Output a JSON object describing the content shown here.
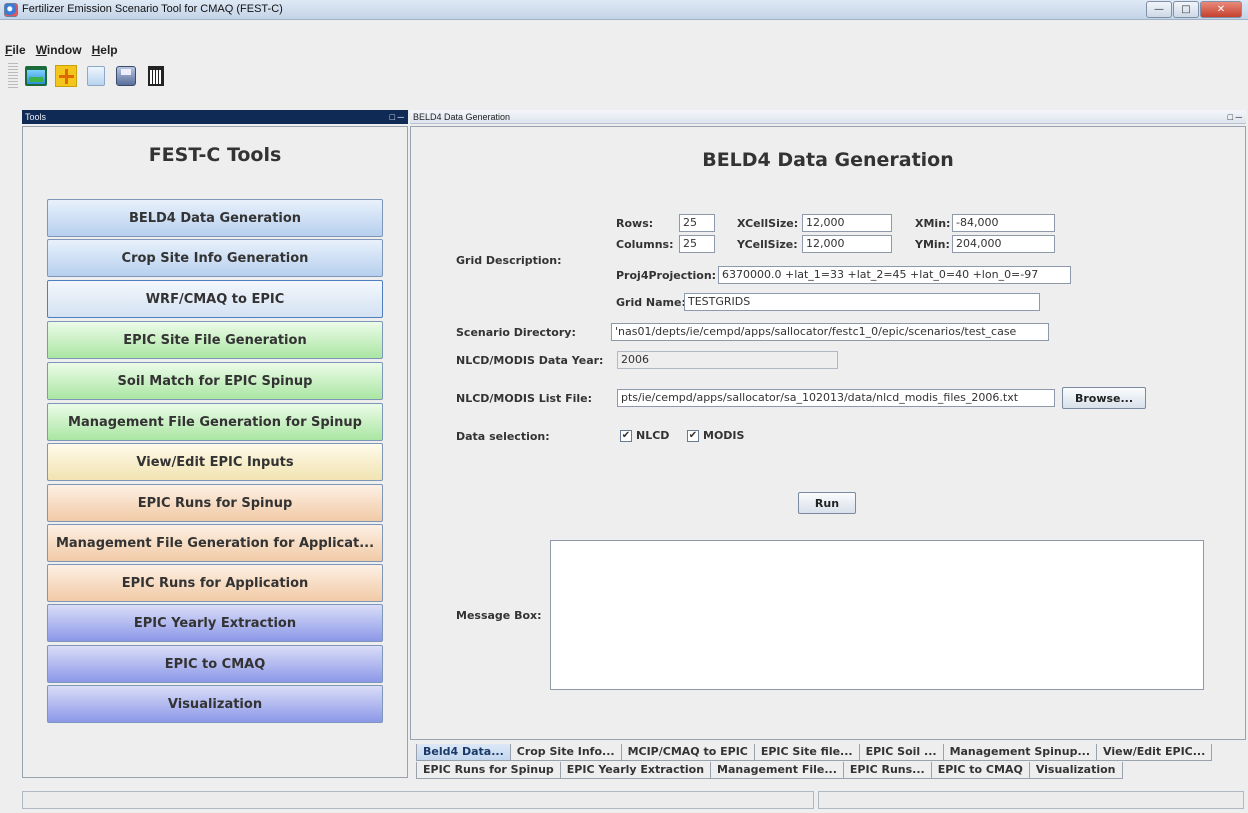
{
  "window": {
    "title": "Fertilizer Emission Scenario Tool for CMAQ (FEST-C)"
  },
  "menu": [
    {
      "mnemonic": "F",
      "rest": "ile"
    },
    {
      "mnemonic": "W",
      "rest": "indow"
    },
    {
      "mnemonic": "H",
      "rest": "elp"
    }
  ],
  "toolbar": [
    "open-icon",
    "add-icon",
    "copy-icon",
    "save-icon",
    "trash-icon"
  ],
  "tools_panel": {
    "header": "Tools",
    "title": "FEST-C Tools",
    "buttons": [
      "BELD4 Data Generation",
      "Crop Site Info Generation",
      "WRF/CMAQ to EPIC",
      "EPIC Site File Generation",
      "Soil Match for EPIC Spinup",
      "Management File Generation for Spinup",
      "View/Edit EPIC Inputs",
      "EPIC Runs for Spinup",
      "Management File Generation for Applicat...",
      "EPIC Runs for Application",
      "EPIC Yearly Extraction",
      "EPIC to CMAQ",
      "Visualization"
    ]
  },
  "main_panel": {
    "header": "BELD4 Data Generation",
    "title": "BELD4 Data Generation",
    "grid": {
      "label": "Grid Description:",
      "rows_label": "Rows:",
      "rows": "25",
      "columns_label": "Columns:",
      "columns": "25",
      "xcell_label": "XCellSize:",
      "xcell": "12,000",
      "ycell_label": "YCellSize:",
      "ycell": "12,000",
      "xmin_label": "XMin:",
      "xmin": "-84,000",
      "ymin_label": "YMin:",
      "ymin": "204,000",
      "proj_label": "Proj4Projection:",
      "proj": "6370000.0 +lat_1=33 +lat_2=45 +lat_0=40 +lon_0=-97",
      "name_label": "Grid Name:",
      "name": "TESTGRIDS"
    },
    "scenario_label": "Scenario Directory:",
    "scenario": "'nas01/depts/ie/cempd/apps/sallocator/festc1_0/epic/scenarios/test_case",
    "year_label": "NLCD/MODIS Data Year:",
    "year": "2006",
    "listfile_label": "NLCD/MODIS List File:",
    "listfile": "pts/ie/cempd/apps/sallocator/sa_102013/data/nlcd_modis_files_2006.txt",
    "browse": "Browse...",
    "selection_label": "Data selection:",
    "nlcd": "NLCD",
    "modis": "MODIS",
    "run": "Run",
    "message_label": "Message Box:"
  },
  "tabs_row1": [
    "Beld4 Data...",
    "Crop Site Info...",
    "MCIP/CMAQ to EPIC",
    "EPIC Site file...",
    "EPIC Soil ...",
    "Management Spinup...",
    "View/Edit EPIC..."
  ],
  "tabs_row2": [
    "EPIC Runs for Spinup",
    "EPIC Yearly Extraction",
    "Management File...",
    "EPIC Runs...",
    "EPIC to CMAQ",
    "Visualization"
  ],
  "colors": {
    "panel_header": "#0f2a55",
    "blue": "#b7d0ee",
    "green": "#aae6a3",
    "yellow": "#f1e3b1",
    "orange": "#f1caa6",
    "purple": "#8c98e8"
  }
}
